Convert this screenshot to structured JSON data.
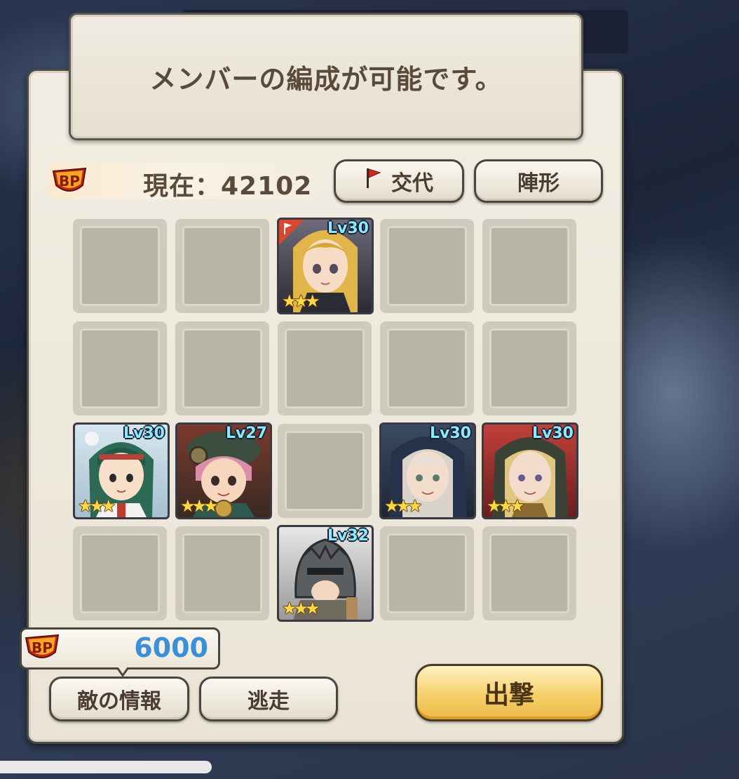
{
  "message": "メンバーの編成が可能です。",
  "bp": {
    "icon": "bp-badge-icon",
    "current_label": "現在：42102",
    "current_value": 42102
  },
  "buttons": {
    "swap": "交代",
    "formation": "陣形",
    "enemy_info": "敵の情報",
    "escape": "逃走",
    "sortie": "出撃"
  },
  "enemy_bp": {
    "icon": "bp-badge-icon",
    "value": "6000"
  },
  "units": [
    {
      "level": "Lv30",
      "stars": "★★★",
      "rarity": 3,
      "leader": true,
      "portrait": "blonde-girl"
    },
    {
      "level": "Lv30",
      "stars": "★★★",
      "rarity": 3,
      "leader": false,
      "portrait": "green-hair-girl"
    },
    {
      "level": "Lv27",
      "stars": "★★★",
      "rarity": 3,
      "leader": false,
      "portrait": "pink-hair-boy-goggles"
    },
    {
      "level": "Lv30",
      "stars": "★★★",
      "rarity": 3,
      "leader": false,
      "portrait": "white-hair-hooded-woman"
    },
    {
      "level": "Lv30",
      "stars": "★★★",
      "rarity": 3,
      "leader": false,
      "portrait": "blonde-hooded-woman-red"
    },
    {
      "level": "Lv32",
      "stars": "★★★",
      "rarity": 3,
      "leader": false,
      "portrait": "armored-helmet-knight"
    }
  ],
  "colors": {
    "panel": "#efeadf",
    "border": "#4e4a44",
    "text": "#5a4a3a",
    "level": "#8fe6ff",
    "enemy_bp": "#3b8fd8",
    "sortie_button": "#f6cf6a"
  }
}
